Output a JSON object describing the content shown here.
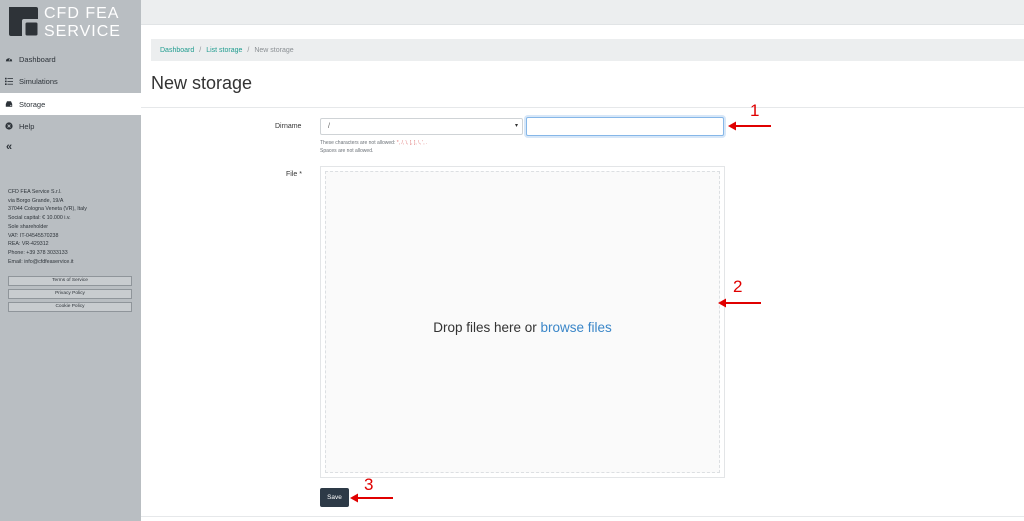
{
  "brand": {
    "line1": "CFD FEA",
    "line2": "SERVICE"
  },
  "sidebar": {
    "items": [
      {
        "label": "Dashboard",
        "icon": "dashboard-icon"
      },
      {
        "label": "Simulations",
        "icon": "list-icon"
      },
      {
        "label": "Storage",
        "icon": "hdd-icon",
        "active": true
      },
      {
        "label": "Help",
        "icon": "help-icon"
      }
    ],
    "collapse_label": "«"
  },
  "company": {
    "lines": [
      "CFD FEA Service S.r.l.",
      "via Borgo Grande, 19/A",
      "37044 Cologna Veneta (VR), Italy",
      "Social capital: € 10.000 i.v.",
      "Sole shareholder",
      "VAT: IT-04545570238",
      "REA: VR-429312",
      "Phone: +39 378 3033133",
      "Email: info@cfdfeaservice.it"
    ]
  },
  "legal_links": [
    "Terms of Service",
    "Privacy Policy",
    "Cookie Policy"
  ],
  "breadcrumb": {
    "items": [
      "Dashboard",
      "List storage"
    ],
    "current": "New storage",
    "separator": "/"
  },
  "page": {
    "title": "New storage"
  },
  "form": {
    "dirname_label": "Dirname",
    "dirname_select_value": "/",
    "dirname_input_value": "",
    "help_line1_prefix": "These characters are not allowed: ",
    "help_line1_chars": "*, /, \\, [, ], \\, ', .",
    "help_line2": "Spaces are not allowed.",
    "file_label": "File *",
    "drop_text_prefix": "Drop files here or",
    "drop_link": "browse files",
    "save_label": "Save"
  },
  "annotations": [
    "1",
    "2",
    "3"
  ],
  "colors": {
    "accent": "#1f9c8f",
    "link": "#3a86c8",
    "save_bg": "#2d3a47",
    "annotation": "#e00000",
    "sidebar_bg": "#b9bec2"
  }
}
